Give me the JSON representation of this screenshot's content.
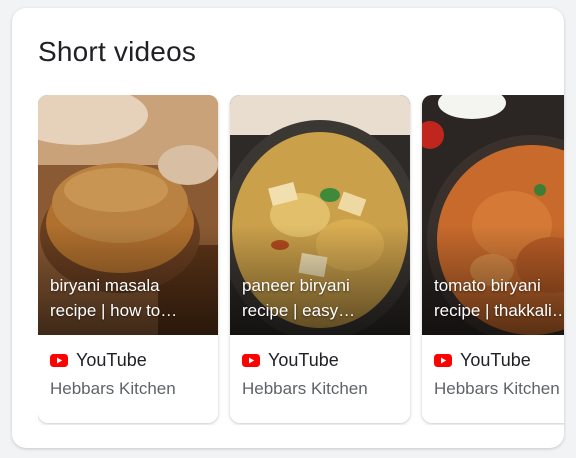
{
  "section": {
    "title": "Short videos"
  },
  "videos": [
    {
      "title_line1": "biryani masala",
      "title_line2": "recipe | how to…",
      "source": "YouTube",
      "channel": "Hebbars Kitchen"
    },
    {
      "title_line1": "paneer biryani",
      "title_line2": "recipe | easy…",
      "source": "YouTube",
      "channel": "Hebbars Kitchen"
    },
    {
      "title_line1": "tomato biryani",
      "title_line2": "recipe | thakkali…",
      "source": "YouTube",
      "channel": "Hebbars Kitchen"
    }
  ],
  "colors": {
    "youtube_red": "#ff0000",
    "title_text": "#202124",
    "secondary_text": "#5f6368"
  },
  "icons": {
    "source_icon": "youtube-play-icon"
  }
}
